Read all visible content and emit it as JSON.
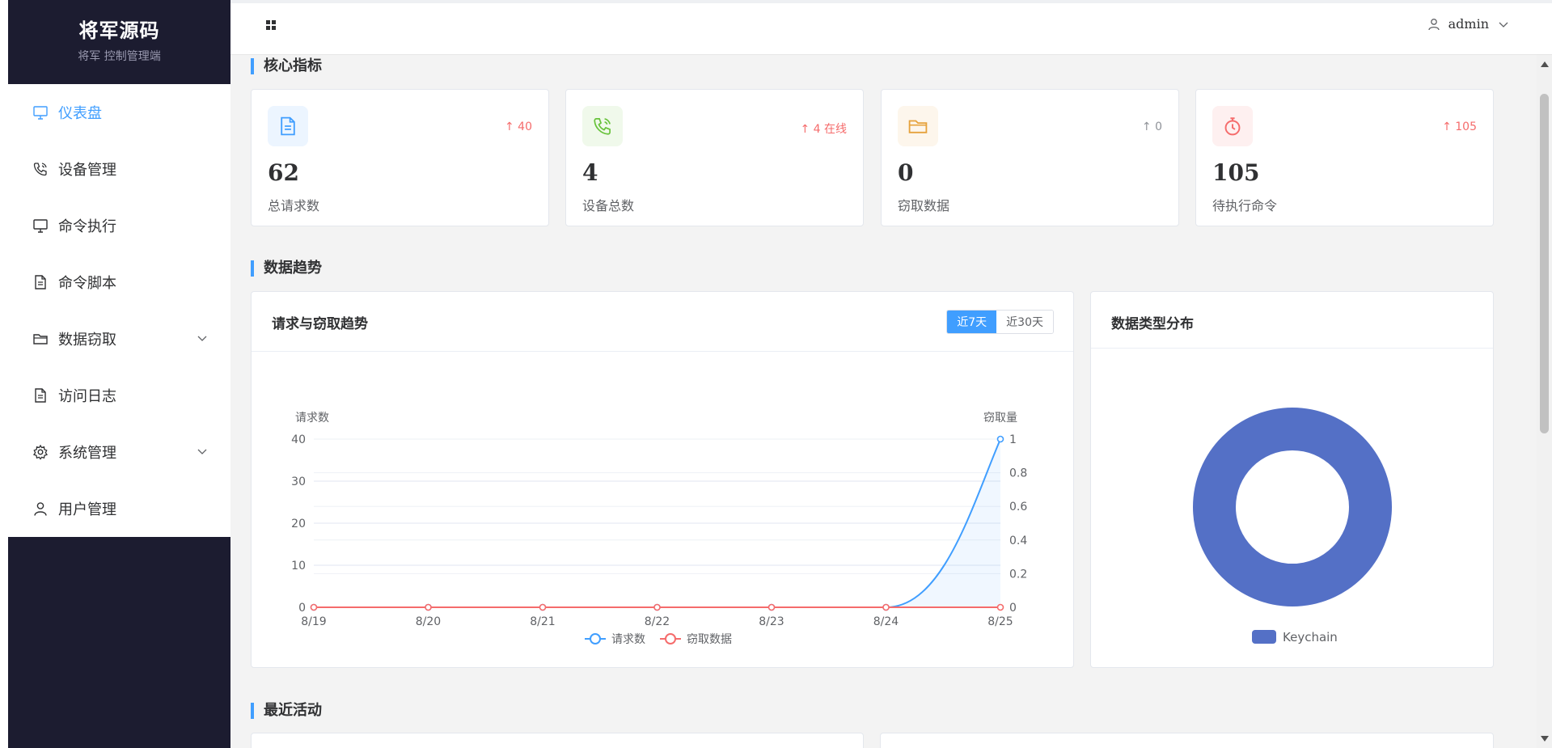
{
  "brand": {
    "title": "将军源码",
    "subtitle": "将军 控制管理端"
  },
  "sidebar": {
    "items": [
      {
        "label": "仪表盘",
        "icon": "monitor-icon",
        "active": true
      },
      {
        "label": "设备管理",
        "icon": "phone-icon"
      },
      {
        "label": "命令执行",
        "icon": "monitor-icon"
      },
      {
        "label": "命令脚本",
        "icon": "document-icon"
      },
      {
        "label": "数据窃取",
        "icon": "folder-icon",
        "expandable": true
      },
      {
        "label": "访问日志",
        "icon": "document-icon"
      },
      {
        "label": "系统管理",
        "icon": "gear-icon",
        "expandable": true
      },
      {
        "label": "用户管理",
        "icon": "user-icon"
      }
    ]
  },
  "header": {
    "user": "admin"
  },
  "sections": {
    "metrics": "核心指标",
    "trends": "数据趋势",
    "recent": "最近活动"
  },
  "stats": [
    {
      "value": "62",
      "label": "总请求数",
      "trend": "↑ 40",
      "trend_color": "#f56c6c",
      "icon": "document-icon",
      "icon_color": "#409eff",
      "icon_bg": "#ecf5ff"
    },
    {
      "value": "4",
      "label": "设备总数",
      "trend": "↑ 4 在线",
      "trend_color": "#f56c6c",
      "icon": "phone-icon",
      "icon_color": "#67c23a",
      "icon_bg": "#f0f9eb"
    },
    {
      "value": "0",
      "label": "窃取数据",
      "trend": "↑ 0",
      "trend_color": "#909399",
      "icon": "folder-icon",
      "icon_color": "#e6a23c",
      "icon_bg": "#fdf6ec"
    },
    {
      "value": "105",
      "label": "待执行命令",
      "trend": "↑ 105",
      "trend_color": "#f56c6c",
      "icon": "stopwatch-icon",
      "icon_color": "#f56c6c",
      "icon_bg": "#fef0f0"
    }
  ],
  "trend_panel": {
    "title": "请求与窃取趋势",
    "range_options": [
      "近7天",
      "近30天"
    ],
    "selected_range": "近7天"
  },
  "dist_panel": {
    "title": "数据类型分布"
  },
  "chart_data": [
    {
      "type": "line",
      "x": [
        "8/19",
        "8/20",
        "8/21",
        "8/22",
        "8/23",
        "8/24",
        "8/25"
      ],
      "ylabel": "请求数",
      "ylabel_right": "窃取量",
      "ylim": [
        0,
        40
      ],
      "ylim_right": [
        0,
        1
      ],
      "yticks": [
        0,
        10,
        20,
        30,
        40
      ],
      "yticks_right": [
        0,
        0.2,
        0.4,
        0.6,
        0.8,
        1
      ],
      "series": [
        {
          "name": "请求数",
          "values": [
            0,
            0,
            0,
            0,
            0,
            0,
            40
          ],
          "color": "#409eff",
          "axis": "left",
          "area": true
        },
        {
          "name": "窃取数据",
          "values": [
            0,
            0,
            0,
            0,
            0,
            0,
            0
          ],
          "color": "#f56c6c",
          "axis": "right"
        }
      ],
      "grid": true,
      "legend": "bottom"
    },
    {
      "type": "pie",
      "donut": true,
      "labels": [
        "Keychain"
      ],
      "values": [
        100
      ],
      "colors": [
        "#5470c6"
      ],
      "legend": "bottom"
    }
  ],
  "colors": {
    "accent": "#409eff",
    "sidebar_bg": "#1c1c30"
  }
}
